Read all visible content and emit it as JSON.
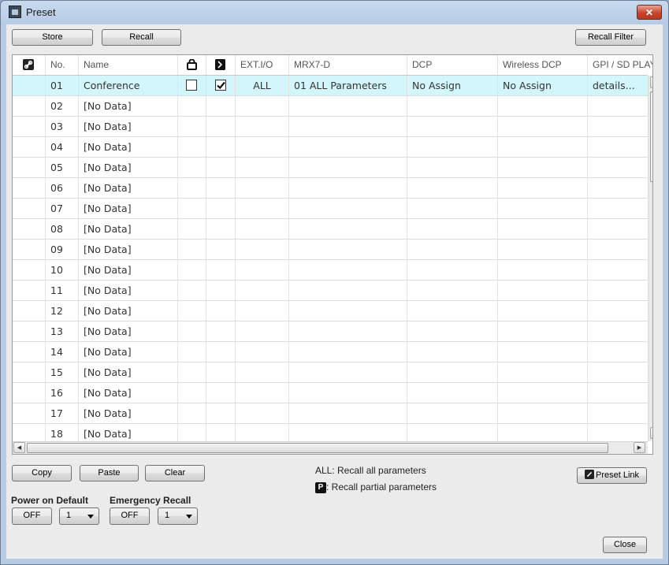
{
  "window": {
    "title": "Preset",
    "close_glyph": "✕"
  },
  "toolbar": {
    "store_label": "Store",
    "recall_label": "Recall",
    "recall_filter_label": "Recall Filter"
  },
  "grid": {
    "columns": {
      "link_icon": "link-icon",
      "no": "No.",
      "name": "Name",
      "lock_icon": "lock-icon",
      "clock_icon": "clock-icon",
      "ext_io": "EXT.I/O",
      "mrx7d": "MRX7-D",
      "dcp": "DCP",
      "wireless_dcp": "Wireless DCP",
      "gpi": "GPI / SD PLAY"
    },
    "rows": [
      {
        "no": "01",
        "name": "Conference",
        "lock": false,
        "clock": true,
        "ext_io": "ALL",
        "mrx7d": "01 ALL Parameters",
        "dcp": "No Assign",
        "wireless_dcp": "No Assign",
        "gpi": "details..."
      },
      {
        "no": "02",
        "name": "[No Data]"
      },
      {
        "no": "03",
        "name": "[No Data]"
      },
      {
        "no": "04",
        "name": "[No Data]"
      },
      {
        "no": "05",
        "name": "[No Data]"
      },
      {
        "no": "06",
        "name": "[No Data]"
      },
      {
        "no": "07",
        "name": "[No Data]"
      },
      {
        "no": "08",
        "name": "[No Data]"
      },
      {
        "no": "09",
        "name": "[No Data]"
      },
      {
        "no": "10",
        "name": "[No Data]"
      },
      {
        "no": "11",
        "name": "[No Data]"
      },
      {
        "no": "12",
        "name": "[No Data]"
      },
      {
        "no": "13",
        "name": "[No Data]"
      },
      {
        "no": "14",
        "name": "[No Data]"
      },
      {
        "no": "15",
        "name": "[No Data]"
      },
      {
        "no": "16",
        "name": "[No Data]"
      },
      {
        "no": "17",
        "name": "[No Data]"
      },
      {
        "no": "18",
        "name": "[No Data]"
      }
    ]
  },
  "edit": {
    "copy_label": "Copy",
    "paste_label": "Paste",
    "clear_label": "Clear"
  },
  "legend": {
    "all_text": "ALL: Recall all parameters",
    "p_icon": "P",
    "p_text": ": Recall partial parameters"
  },
  "preset_link_label": "Preset Link",
  "power_on_default": {
    "label": "Power on Default",
    "toggle": "OFF",
    "value": "1"
  },
  "emergency_recall": {
    "label": "Emergency Recall",
    "toggle": "OFF",
    "value": "1"
  },
  "close_label": "Close"
}
